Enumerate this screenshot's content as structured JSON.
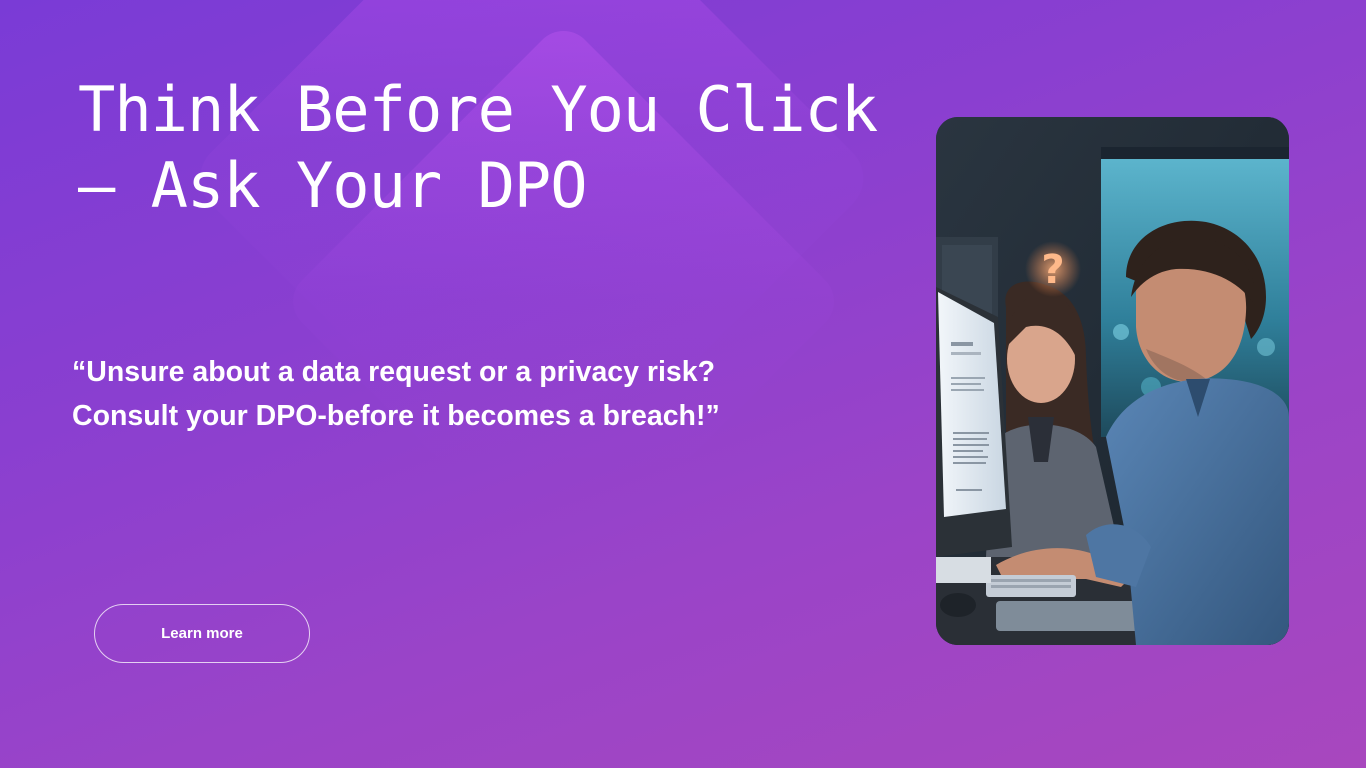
{
  "headline": "Think Before You Click – Ask Your DPO",
  "quote": {
    "line1": "“Unsure about a data request or a privacy risk?",
    "line2": "Consult your DPO-before it becomes a breach!”"
  },
  "cta": {
    "label": "Learn more"
  },
  "photo": {
    "alt": "two office workers looking at a computer monitor with a question mark"
  },
  "colors": {
    "background_top": "#7a3bd6",
    "background_bottom": "#a847be",
    "text": "#ffffff"
  }
}
